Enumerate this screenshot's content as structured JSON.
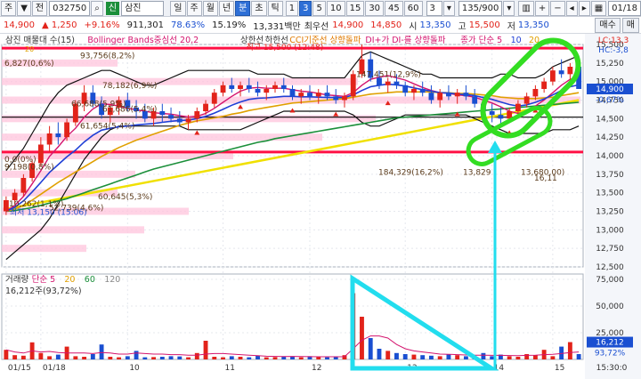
{
  "toolbar": {
    "left_label": "주",
    "down_arrow": "▼",
    "prev_label": "전",
    "code": "032750",
    "tag": "신",
    "name": "삼진",
    "period_buttons": [
      "일",
      "주",
      "월",
      "년",
      "분",
      "초",
      "틱"
    ],
    "active_period": "분",
    "interval_buttons": [
      "1",
      "3",
      "5",
      "10",
      "15",
      "30",
      "45",
      "60"
    ],
    "active_interval": "3",
    "unit_value": "3",
    "count": "135/900",
    "date": "01/18"
  },
  "quote": {
    "price": "14,900",
    "change": "▲ 1,250",
    "change_rate": "+9.16%",
    "volume": "911,301",
    "volume_ratio": "78.63%",
    "turnover": "15.19%",
    "amount": "13,331백만",
    "best_ask_label": "최우선",
    "best_ask": "14,900",
    "best_bid": "14,850",
    "open_label": "시",
    "open": "13,350",
    "high_label": "고",
    "high": "15,500",
    "low_label": "저",
    "low": "13,350",
    "buy_label": "매수",
    "sell_label": "매"
  },
  "legend": {
    "price": [
      {
        "text": "삼진 매물대 수(15)",
        "color": "#333333"
      },
      {
        "text": "Bollinger Bands중심선 20,2",
        "color": "#d4146e"
      },
      {
        "text": "상한선",
        "color": "#333333"
      },
      {
        "text": "하한선",
        "color": "#333333"
      },
      {
        "text": "CCI기준선 상향돌파",
        "color": "#e07a00"
      },
      {
        "text": "DI+가 DI-를 상향돌파",
        "color": "#d4146e"
      },
      {
        "text": "종가 단순 5",
        "color": "#d4146e"
      },
      {
        "text": "10",
        "color": "#1f3fd6"
      },
      {
        "text": "20",
        "color": "#e0a000"
      }
    ],
    "volume": [
      {
        "text": "거래량",
        "color": "#333333"
      },
      {
        "text": "단순 5",
        "color": "#d4146e"
      },
      {
        "text": "20",
        "color": "#e0a000"
      },
      {
        "text": "60",
        "color": "#1b8f3a"
      },
      {
        "text": "120",
        "color": "#888888"
      }
    ],
    "sub_val": "20",
    "volume_value": "16,212주(93,72%)"
  },
  "annotations": {
    "top_high": "최고 15,500 (12:48)",
    "low": "최저 13,150 (15:06)",
    "vp": [
      "6,827(0,6%)",
      "93,756(8,2%)",
      "78,182(6,9%)",
      "147,451(12,9%)",
      "66,688(5,9%)",
      "61,686(5,4%)",
      "61,654(5,4%)",
      "0,0(0%)",
      "9,198(0,8%)",
      "10,262(1,1%)",
      "52,739(4,6%)",
      "60,645(5,3%)",
      "184,329(16,2%)",
      "13,829",
      "13,680,00)",
      "16,11"
    ]
  },
  "axis": {
    "price_ticks": [
      "15,500",
      "15,250",
      "15,000",
      "14,750",
      "14,500",
      "14,250",
      "14,000",
      "13,750",
      "13,500",
      "13,250",
      "13,000",
      "12,750",
      "12,500"
    ],
    "lc_label": "LC:13,3",
    "hc_label": "HC:-3,8",
    "current_price": "14,900",
    "current_rate": "-0,67%",
    "volume_ticks": [
      "75,000",
      "50,000",
      "25,000"
    ],
    "volume_current": "16,212",
    "volume_rate": "93,72%",
    "time_ticks": [
      "01/15",
      "01/18",
      "10",
      "11",
      "12",
      "13",
      "14",
      "15"
    ],
    "clock": "15:30:0"
  },
  "colors": {
    "up": "#e2231a",
    "down": "#1a4fd1",
    "ma5": "#d4146e",
    "ma10": "#1f3fd6",
    "ma20": "#e0a000",
    "ma60": "#1b8f3a",
    "trend": "#f0e000",
    "resistance": "#ff1044",
    "highlight_green": "#33dd22",
    "highlight_cyan": "#22ddee"
  },
  "chart_data": {
    "type": "candlestick",
    "price": {
      "ylim": [
        12500,
        15500
      ],
      "candles": [
        [
          13250,
          13450,
          13200,
          13400
        ],
        [
          13400,
          13550,
          13350,
          13500
        ],
        [
          13500,
          13750,
          13450,
          13700
        ],
        [
          13700,
          13950,
          13650,
          13900
        ],
        [
          13900,
          14250,
          13850,
          14150
        ],
        [
          14150,
          14400,
          14050,
          14300
        ],
        [
          14300,
          14450,
          14150,
          14250
        ],
        [
          14250,
          14500,
          14200,
          14450
        ],
        [
          14450,
          14750,
          14400,
          14700
        ],
        [
          14700,
          14950,
          14600,
          14850
        ],
        [
          14850,
          14950,
          14650,
          14700
        ],
        [
          14700,
          14800,
          14500,
          14550
        ],
        [
          14550,
          14700,
          14450,
          14650
        ],
        [
          14650,
          14800,
          14550,
          14750
        ],
        [
          14750,
          14850,
          14600,
          14650
        ],
        [
          14650,
          14750,
          14500,
          14600
        ],
        [
          14600,
          14700,
          14450,
          14500
        ],
        [
          14500,
          14650,
          14400,
          14600
        ],
        [
          14600,
          14700,
          14450,
          14550
        ],
        [
          14550,
          14650,
          14450,
          14500
        ],
        [
          14500,
          14600,
          14400,
          14450
        ],
        [
          14450,
          14550,
          14350,
          14500
        ],
        [
          14500,
          14650,
          14450,
          14600
        ],
        [
          14600,
          14750,
          14550,
          14700
        ],
        [
          14700,
          14900,
          14650,
          14850
        ],
        [
          14850,
          15000,
          14800,
          14950
        ],
        [
          14950,
          15050,
          14850,
          14900
        ],
        [
          14900,
          15000,
          14800,
          14950
        ],
        [
          14950,
          15050,
          14850,
          14900
        ],
        [
          14900,
          15000,
          14800,
          14850
        ],
        [
          14850,
          14950,
          14750,
          14900
        ],
        [
          14900,
          15000,
          14850,
          14950
        ],
        [
          14950,
          15050,
          14850,
          14900
        ],
        [
          14900,
          14950,
          14750,
          14800
        ],
        [
          14800,
          14900,
          14700,
          14850
        ],
        [
          14850,
          14950,
          14750,
          14800
        ],
        [
          14800,
          14900,
          14700,
          14850
        ],
        [
          14850,
          14950,
          14750,
          14800
        ],
        [
          14800,
          14900,
          14700,
          14750
        ],
        [
          14750,
          14850,
          14650,
          14800
        ],
        [
          14800,
          15150,
          14750,
          15100
        ],
        [
          15100,
          15500,
          15050,
          15300
        ],
        [
          15300,
          15400,
          15000,
          15050
        ],
        [
          15050,
          15150,
          14900,
          14950
        ],
        [
          14950,
          15050,
          14850,
          15000
        ],
        [
          15000,
          15100,
          14900,
          14950
        ],
        [
          14950,
          15000,
          14800,
          14850
        ],
        [
          14850,
          14950,
          14750,
          14900
        ],
        [
          14900,
          15000,
          14800,
          14850
        ],
        [
          14850,
          14950,
          14700,
          14750
        ],
        [
          14750,
          14900,
          14650,
          14850
        ],
        [
          14850,
          14950,
          14750,
          14800
        ],
        [
          14800,
          14900,
          14700,
          14850
        ],
        [
          14850,
          14950,
          14750,
          14800
        ],
        [
          14800,
          14900,
          14650,
          14700
        ],
        [
          14700,
          14800,
          14550,
          14600
        ],
        [
          14600,
          14700,
          14450,
          14550
        ],
        [
          14550,
          14650,
          14400,
          14500
        ],
        [
          14500,
          14650,
          14450,
          14600
        ],
        [
          14600,
          14750,
          14550,
          14700
        ],
        [
          14700,
          14850,
          14650,
          14800
        ],
        [
          14800,
          14950,
          14750,
          14900
        ],
        [
          14900,
          15050,
          14850,
          15000
        ],
        [
          15000,
          15200,
          14950,
          15150
        ],
        [
          15150,
          15300,
          15050,
          15100
        ],
        [
          15100,
          15250,
          15000,
          15200
        ],
        [
          15200,
          15350,
          15100,
          14900
        ]
      ],
      "ma5": [
        13250,
        13330,
        13450,
        13620,
        13800,
        13990,
        14120,
        14260,
        14370,
        14520,
        14630,
        14700,
        14690,
        14670,
        14640,
        14620,
        14600,
        14580,
        14570,
        14560,
        14540,
        14520,
        14530,
        14570,
        14640,
        14720,
        14800,
        14870,
        14910,
        14920,
        14910,
        14910,
        14910,
        14890,
        14870,
        14860,
        14840,
        14820,
        14810,
        14800,
        14850,
        14950,
        15030,
        15060,
        15080,
        15050,
        15020,
        14970,
        14920,
        14880,
        14850,
        14840,
        14820,
        14810,
        14790,
        14750,
        14710,
        14660,
        14600,
        14570,
        14600,
        14670,
        14750,
        14850,
        14950,
        15030,
        15060
      ],
      "ma20": [
        13250,
        13280,
        13330,
        13400,
        13480,
        13560,
        13640,
        13710,
        13780,
        13850,
        13920,
        13990,
        14050,
        14110,
        14160,
        14210,
        14250,
        14290,
        14330,
        14370,
        14410,
        14440,
        14470,
        14490,
        14510,
        14530,
        14560,
        14580,
        14610,
        14630,
        14650,
        14670,
        14690,
        14710,
        14720,
        14730,
        14740,
        14750,
        14760,
        14770,
        14790,
        14810,
        14830,
        14840,
        14850,
        14860,
        14860,
        14860,
        14860,
        14860,
        14850,
        14850,
        14840,
        14840,
        14830,
        14820,
        14810,
        14790,
        14780,
        14770,
        14770,
        14770,
        14780,
        14790,
        14810,
        14830,
        14850
      ],
      "ma60": [
        13250,
        13260,
        13280,
        13300,
        13330,
        13360,
        13390,
        13420,
        13460,
        13500,
        13540,
        13580,
        13620,
        13660,
        13700,
        13740,
        13780,
        13820,
        13850,
        13880,
        13910,
        13940,
        13970,
        14000,
        14030,
        14060,
        14090,
        14120,
        14150,
        14180,
        14200,
        14230,
        14250,
        14270,
        14290,
        14310,
        14330,
        14350,
        14370,
        14390,
        14410,
        14430,
        14450,
        14470,
        14490,
        14510,
        14520,
        14530,
        14540,
        14550,
        14560,
        14570,
        14580,
        14590,
        14600,
        14610,
        14620,
        14630,
        14640,
        14650,
        14660,
        14670,
        14680,
        14690,
        14700,
        14710,
        14720
      ],
      "bb_upper": [
        13800,
        13950,
        14100,
        14300,
        14500,
        14700,
        14850,
        14950,
        15000,
        15050,
        15100,
        15150,
        15150,
        15100,
        15050,
        15000,
        14950,
        14950,
        15000,
        15050,
        15100,
        15150,
        15150,
        15150,
        15150,
        15150,
        15150,
        15150,
        15150,
        15100,
        15100,
        15100,
        15100,
        15050,
        15050,
        15050,
        15050,
        15050,
        15050,
        15050,
        15200,
        15350,
        15400,
        15350,
        15300,
        15250,
        15200,
        15150,
        15100,
        15100,
        15050,
        15050,
        15050,
        15050,
        15050,
        15050,
        15050,
        15100,
        15100,
        15050,
        15050,
        15050,
        15100,
        15200,
        15250,
        15300,
        15350
      ],
      "bb_lower": [
        12600,
        12700,
        12800,
        12900,
        13000,
        13150,
        13350,
        13550,
        13750,
        13950,
        14100,
        14250,
        14350,
        14400,
        14400,
        14400,
        14400,
        14400,
        14400,
        14400,
        14400,
        14350,
        14350,
        14350,
        14350,
        14350,
        14350,
        14350,
        14400,
        14450,
        14500,
        14550,
        14600,
        14600,
        14600,
        14600,
        14600,
        14600,
        14600,
        14600,
        14550,
        14450,
        14400,
        14400,
        14450,
        14500,
        14550,
        14550,
        14550,
        14550,
        14550,
        14550,
        14550,
        14550,
        14500,
        14450,
        14400,
        14350,
        14300,
        14300,
        14300,
        14300,
        14300,
        14350,
        14350,
        14350,
        14400
      ],
      "trend_line": [
        [
          0,
          13280
        ],
        [
          66,
          14750
        ]
      ],
      "resistance_level": 15450,
      "support_level": 14050,
      "mid_level": 14520
    },
    "volume": {
      "ylim": [
        0,
        80000
      ],
      "values": [
        9000,
        4000,
        3500,
        16000,
        6000,
        3000,
        4500,
        12000,
        3000,
        2500,
        5000,
        14000,
        2500,
        2000,
        3000,
        8000,
        2000,
        2200,
        2500,
        3000,
        2800,
        2000,
        6000,
        17500,
        2500,
        2000,
        3000,
        2500,
        2000,
        3500,
        2000,
        2200,
        2500,
        2800,
        2000,
        3000,
        2500,
        2000,
        2200,
        4000,
        62000,
        40000,
        20000,
        10000,
        8000,
        6000,
        5000,
        4500,
        4000,
        3500,
        3000,
        5000,
        4000,
        3000,
        2500,
        6000,
        3000,
        4500,
        3000,
        2500,
        5000,
        4000,
        9000,
        3000,
        12000,
        16212,
        5000
      ],
      "ma": [
        9000,
        7000,
        6000,
        8000,
        7000,
        7500,
        6500,
        6000,
        6000,
        6000,
        5500,
        6500,
        6000,
        5000,
        5000,
        6000,
        5500,
        5000,
        5000,
        4500,
        4500,
        4000,
        4000,
        5000,
        5500,
        5500,
        5000,
        4500,
        4000,
        3500,
        3000,
        2800,
        2700,
        2800,
        2700,
        2600,
        2500,
        2500,
        2500,
        2600,
        10000,
        18000,
        22000,
        22000,
        20000,
        14000,
        10000,
        8000,
        7000,
        6000,
        5000,
        4800,
        4500,
        4200,
        4000,
        4000,
        3800,
        3800,
        3700,
        3600,
        3800,
        4000,
        4500,
        4800,
        5500,
        6500,
        7000
      ]
    },
    "time_labels": [
      "01/15",
      "01/18",
      "10",
      "11",
      "12",
      "13",
      "14",
      "15"
    ]
  }
}
